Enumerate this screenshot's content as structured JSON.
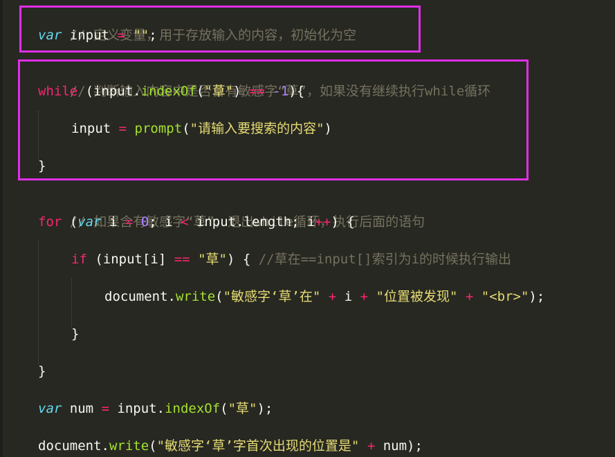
{
  "code": {
    "block1": {
      "comment": "// 定义变量，用于存放输入的内容，初始化为空",
      "decl_kw": "var",
      "decl_name": " input ",
      "decl_eq": "=",
      "decl_sp": " ",
      "decl_val": "\"\"",
      "decl_end": ";"
    },
    "block2": {
      "comment": "// 判断输入内容中是否含有敏感字“草”，如果没有继续执行while循环",
      "while_kw": "while",
      "while_open": " (input.",
      "while_fn": "indexOf",
      "while_p1": "(",
      "while_str": "\"草\"",
      "while_p2": ") ",
      "while_op": "==",
      "while_sp": " ",
      "while_num": "-1",
      "while_close": "){",
      "assign_name": "input ",
      "assign_eq": "=",
      "assign_sp": " ",
      "assign_fn": "prompt",
      "assign_p1": "(",
      "assign_str": "\"请输入要搜索的内容\"",
      "assign_p2": ")",
      "brace_close": "}"
    },
    "block3": {
      "comment": "// 如果含有敏感字“草”，退出while循环，执行后面的语句",
      "for_kw": "for",
      "for_p1": " (",
      "for_var": "var",
      "for_i": " i ",
      "for_eq": "=",
      "for_sp": " ",
      "for_zero": "0",
      "for_semi": "; i ",
      "for_lt": "<",
      "for_rest": " input.length; i",
      "for_inc": "++",
      "for_close": ") {",
      "if_kw": "if",
      "if_p1": " (input[i] ",
      "if_op": "==",
      "if_sp": " ",
      "if_str": "\"草\"",
      "if_close": ") { ",
      "if_comment": "//草在==input[]索引为i的时候执行输出",
      "doc_obj": "document.",
      "doc_fn": "write",
      "doc_p1": "(",
      "doc_s1": "\"敏感字‘草’在\"",
      "doc_sp1": " ",
      "doc_plus1": "+",
      "doc_i": " i ",
      "doc_plus2": "+",
      "doc_sp2": " ",
      "doc_s2": "\"位置被发现\"",
      "doc_sp3": " ",
      "doc_plus3": "+",
      "doc_sp4": " ",
      "doc_s3": "\"<br>\"",
      "doc_end": ");",
      "if_brace_close": "}",
      "for_brace_close": "}"
    },
    "block4": {
      "num_kw": "var",
      "num_name": " num ",
      "num_eq": "=",
      "num_rest": " input.",
      "num_fn": "indexOf",
      "num_p1": "(",
      "num_str": "\"草\"",
      "num_end": ");",
      "out_obj": "document.",
      "out_fn": "write",
      "out_p1": "(",
      "out_str": "\"敏感字‘草’字首次出现的位置是\"",
      "out_sp": " ",
      "out_plus": "+",
      "out_rest": " num);"
    }
  },
  "colors": {
    "background": "#272822",
    "highlight_box": "#e12ee8",
    "comment": "#75715e",
    "keyword": "#f92672",
    "storage": "#66d9ef",
    "string": "#e6db74",
    "number": "#ae81ff",
    "function": "#a6e22e"
  }
}
